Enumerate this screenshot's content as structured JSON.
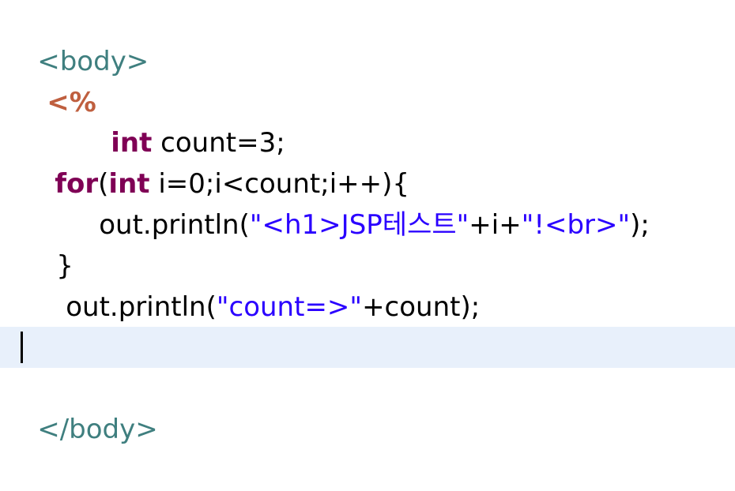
{
  "editor": {
    "lines": {
      "l1": {
        "t1": "<body>"
      },
      "l2": {
        "t1": "<%"
      },
      "l3": {
        "t1": "int",
        "t2": " count=3;"
      },
      "l4": {
        "t1": "for",
        "t2": "(",
        "t3": "int",
        "t4": " i=0;i<count;i++){"
      },
      "l5": {
        "t1": "out.println(",
        "t2": "\"<h1>JSP테스트\"",
        "t3": "+i+",
        "t4": "\"!<br>\"",
        "t5": ");"
      },
      "l6": {
        "t1": "}"
      },
      "l7": {
        "t1": "out.println(",
        "t2": "\"count=>\"",
        "t3": "+count);"
      },
      "l8": {
        "t1": "%>"
      },
      "l9": {},
      "l10": {
        "t1": "</body>"
      }
    }
  }
}
